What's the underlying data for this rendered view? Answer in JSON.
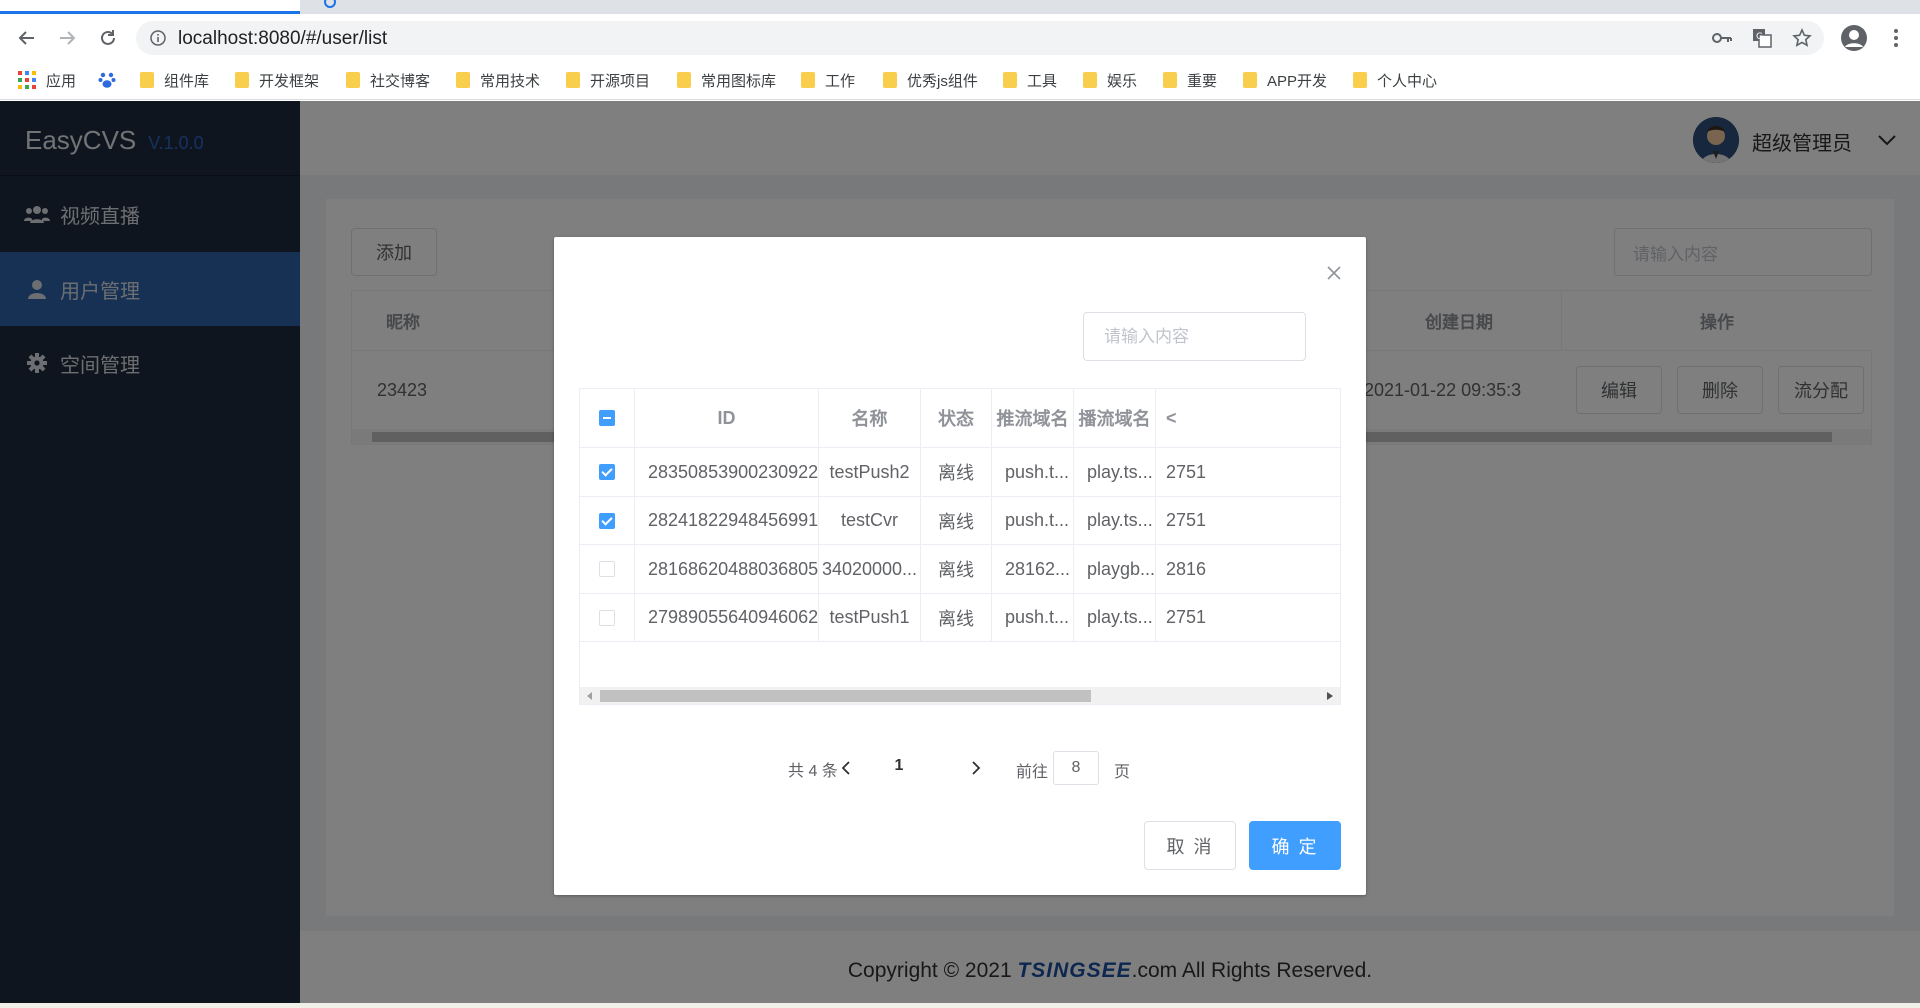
{
  "browser": {
    "url": "localhost:8080/#/user/list",
    "bookmarks": [
      "应用",
      "组件库",
      "开发框架",
      "社交博客",
      "常用技术",
      "开源项目",
      "常用图标库",
      "工作",
      "优秀js组件",
      "工具",
      "娱乐",
      "重要",
      "APP开发",
      "个人中心"
    ]
  },
  "sidebar": {
    "brand": "EasyCVS",
    "version": "V.1.0.0",
    "items": [
      {
        "label": "视频直播",
        "icon": "users-icon",
        "active": false
      },
      {
        "label": "用户管理",
        "icon": "user-icon",
        "active": true
      },
      {
        "label": "空间管理",
        "icon": "gear-icon",
        "active": false
      }
    ]
  },
  "header": {
    "username": "超级管理员"
  },
  "page": {
    "add_label": "添加",
    "search_placeholder": "请输入内容",
    "columns": {
      "nickname": "昵称",
      "created": "创建日期",
      "ops": "操作"
    },
    "row": {
      "nickname": "23423",
      "created": "2021-01-22 09:35:3"
    },
    "ops": [
      "编辑",
      "删除",
      "流分配"
    ]
  },
  "dialog": {
    "search_placeholder": "请输入内容",
    "columns": [
      "ID",
      "名称",
      "状态",
      "推流域名",
      "播流域名",
      "<"
    ],
    "rows": [
      {
        "checked": true,
        "id": "28350853900230922...",
        "name": "testPush2",
        "status": "离线",
        "push": "push.t...",
        "play": "play.ts...",
        "extra": "2751"
      },
      {
        "checked": true,
        "id": "28241822948456991...",
        "name": "testCvr",
        "status": "离线",
        "push": "push.t...",
        "play": "play.ts...",
        "extra": "2751"
      },
      {
        "checked": false,
        "id": "28168620488036805...",
        "name": "34020000...",
        "status": "离线",
        "push": "28162...",
        "play": "playgb...",
        "extra": "2816"
      },
      {
        "checked": false,
        "id": "27989055640946062...",
        "name": "testPush1",
        "status": "离线",
        "push": "push.t...",
        "play": "play.ts...",
        "extra": "2751"
      }
    ],
    "pagination": {
      "total": "共 4 条",
      "current": "1",
      "goto_label": "前往",
      "goto_value": "8",
      "goto_suffix": "页"
    },
    "cancel_label": "取 消",
    "ok_label": "确 定"
  },
  "footer": {
    "prefix": "Copyright © 2021 ",
    "brandmark": "TSINGSEE",
    "suffix": ".com All Rights Reserved."
  },
  "colors": {
    "sidebar_bg": "#1f2a3c",
    "sidebar_active": "#2f62a8",
    "primary": "#409eff"
  }
}
